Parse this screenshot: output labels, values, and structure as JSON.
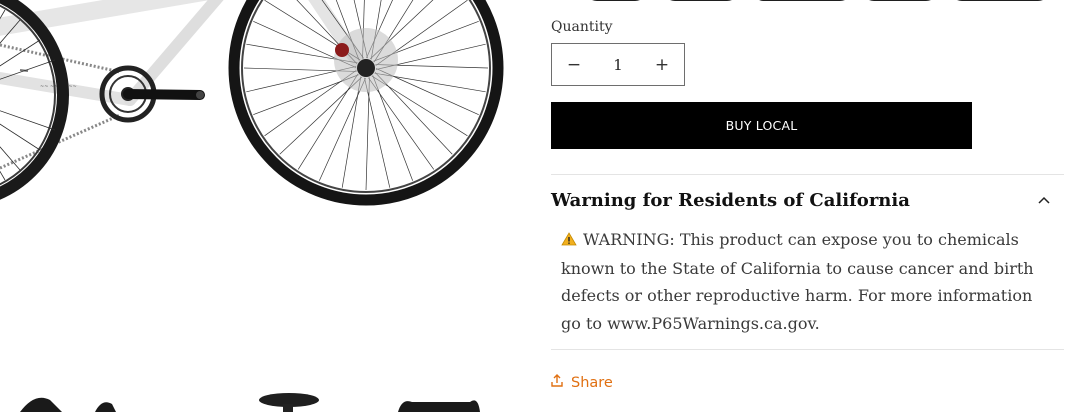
{
  "quantity": {
    "label": "Quantity",
    "value": "1",
    "decrement_symbol": "−",
    "increment_symbol": "+"
  },
  "buy_button": {
    "label": "BUY LOCAL"
  },
  "warning_section": {
    "title": "Warning for Residents of California",
    "icon": "warning-icon",
    "body": "WARNING: This product can expose you to chemicals known to the State of California to cause cancer and birth defects or other reproductive harm. For more information go to www.P65Warnings.ca.gov."
  },
  "share": {
    "label": "Share",
    "icon": "share-icon",
    "color": "#e07012"
  },
  "colors": {
    "button_bg": "#000000",
    "accent": "#e07012",
    "text": "#1f1f1f"
  }
}
